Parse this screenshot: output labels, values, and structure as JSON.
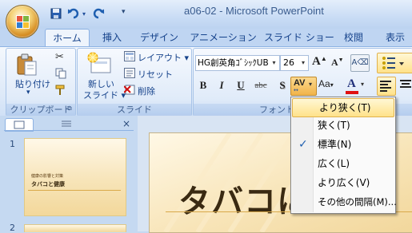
{
  "window": {
    "title": "a06-02 - Microsoft PowerPoint"
  },
  "qat": {
    "save_icon": "save-icon",
    "undo_icon": "undo-icon",
    "redo_icon": "redo-icon",
    "more": "▾"
  },
  "tabs": [
    {
      "label": "ホーム",
      "active": true
    },
    {
      "label": "挿入"
    },
    {
      "label": "デザイン"
    },
    {
      "label": "アニメーション"
    },
    {
      "label": "スライド ショー"
    },
    {
      "label": "校閲"
    },
    {
      "label": "表示"
    }
  ],
  "ribbon": {
    "clipboard": {
      "label": "クリップボード",
      "paste_line1": "貼り付け",
      "paste_arrow": "▾"
    },
    "slides": {
      "label": "スライド",
      "new_slide_line1": "新しい",
      "new_slide_line2": "スライド ▾",
      "layout": "レイアウト ▾",
      "reset": "リセット",
      "delete": "削除"
    },
    "font": {
      "label": "フォント",
      "font_name": "HG創英角ｺﾞｼｯｸUB",
      "font_size": "26",
      "bold": "B",
      "italic": "I",
      "underline": "U",
      "strike": "abc",
      "shadow": "S",
      "spacing": "AV",
      "case": "Aa",
      "color_letter": "A"
    }
  },
  "spacing_menu": {
    "items": [
      {
        "label": "より狭く(T)",
        "highlighted": true
      },
      {
        "label": "狭く(T)"
      },
      {
        "label": "標準(N)",
        "checked": true
      },
      {
        "label": "広く(L)"
      },
      {
        "label": "より広く(V)"
      },
      {
        "label": "その他の間隔(M)..."
      }
    ]
  },
  "slides_pane": {
    "close": "×",
    "slides": [
      {
        "number": "1",
        "title_text": "タバコと健康",
        "subtitle_text": "健康の影響と対策"
      },
      {
        "number": "2"
      }
    ]
  },
  "slide": {
    "title": "タバコに"
  },
  "colors": {
    "accent": "#15428b",
    "ribbon_bg": "#dde9f8",
    "highlight": "#ffe28a",
    "slide_bg": "#f8e5b9",
    "font_color_bar": "#e01010"
  }
}
